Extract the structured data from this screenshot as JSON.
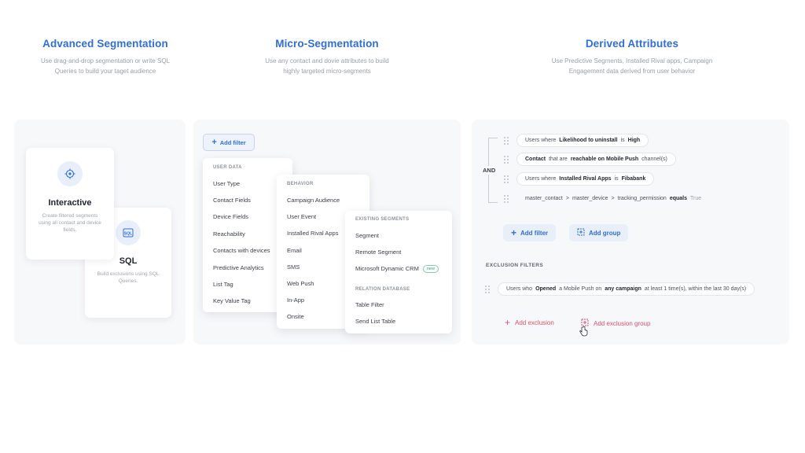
{
  "headers": [
    {
      "title": "Advanced Segmentation",
      "line1": "Use drag-and-drop segmentation or write SQL",
      "line2": "Queries to build your taget audience"
    },
    {
      "title": "Micro-Segmentation",
      "line1": "Use any contact and dovie attributes to build",
      "line2": "highly targeted micro-segments"
    },
    {
      "title": "Derived Attributes",
      "line1": "Use Predictive Segments, Installed Rival apps, Campaign",
      "line2": "Engagement data derived from user behavior"
    }
  ],
  "panel1": {
    "interactive": {
      "title": "Interactive",
      "desc": "Create filtered segments using all contact and device fields.",
      "icon": "target-icon"
    },
    "sql": {
      "title": "SQL",
      "desc": "Build exclusions using SQL Queries.",
      "icon": "sql-icon"
    }
  },
  "panel2": {
    "add_filter": "Add filter",
    "user_data": {
      "heading": "USER DATA",
      "items": [
        "User Type",
        "Contact Fields",
        "Device Fields",
        "Reachability",
        "Contacts with devices",
        "Predictive Analytics",
        "List Tag",
        "Key Value Tag"
      ]
    },
    "behavior": {
      "heading": "BEHAVIOR",
      "items": [
        "Campaign Audience",
        "User Event",
        "Installed Rival Apps",
        "Email",
        "SMS",
        "Web Push",
        "In-App",
        "Onsite"
      ]
    },
    "existing": {
      "heading": "EXISTING SEGMENTS",
      "items": [
        "Segment",
        "Remote Segment",
        "Microsoft Dynamic CRM"
      ],
      "new_badge": "new"
    },
    "relation": {
      "heading": "RELATION DATABASE",
      "items": [
        "Table Filter",
        "Send List Table"
      ]
    }
  },
  "panel3": {
    "and_label": "AND",
    "rules": [
      {
        "parts": [
          [
            "t",
            "Users where"
          ],
          [
            "b",
            "Likelihood to uninstall"
          ],
          [
            "t",
            "is"
          ],
          [
            "b",
            "High"
          ]
        ]
      },
      {
        "parts": [
          [
            "b",
            "Contact"
          ],
          [
            "t",
            "that are"
          ],
          [
            "b",
            "reachable on Mobile Push"
          ],
          [
            "t",
            "channel(s)"
          ]
        ]
      },
      {
        "parts": [
          [
            "t",
            "Users where"
          ],
          [
            "b",
            "Installed Rival Apps"
          ],
          [
            "t",
            "is"
          ],
          [
            "b",
            "Fibabank"
          ]
        ]
      },
      {
        "parts": [
          [
            "t",
            "master_contact"
          ],
          [
            "t",
            ">"
          ],
          [
            "t",
            "master_device"
          ],
          [
            "t",
            ">"
          ],
          [
            "t",
            "tracking_permission"
          ],
          [
            "b",
            "equals"
          ],
          [
            "m",
            "True"
          ]
        ]
      }
    ],
    "add_filter": "Add filter",
    "add_group": "Add group",
    "exclusion_heading": "EXCLUSION FILTERS",
    "exclusion_rule": {
      "parts": [
        [
          "t",
          "Users who"
        ],
        [
          "b",
          "Opened"
        ],
        [
          "t",
          "a Mobile Push on"
        ],
        [
          "b",
          "any campaign"
        ],
        [
          "t",
          "at least 1 time(s), within the last 30 day(s)"
        ]
      ]
    },
    "add_exclusion": "Add exclusion",
    "add_exclusion_group": "Add exclusion group"
  },
  "colors": {
    "accent": "#2f6fd8",
    "danger": "#e0506a",
    "panel": "#f7f8fa"
  }
}
